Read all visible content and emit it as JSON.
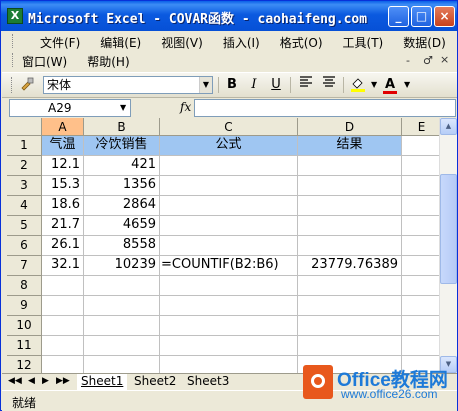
{
  "window": {
    "title": "Microsoft Excel - COVAR函数 - caohaifeng.com",
    "app_icon_glyph": "X"
  },
  "title_buttons": {
    "minimize": "_",
    "maximize": "□",
    "close": "×"
  },
  "menu": {
    "items": [
      "文件(F)",
      "编辑(E)",
      "视图(V)",
      "插入(I)",
      "格式(O)",
      "工具(T)",
      "数据(D)",
      "窗口(W)",
      "帮助(H)"
    ],
    "doc_controls": {
      "minimize": "-",
      "restore": "♂",
      "close": "×"
    }
  },
  "toolbar": {
    "font_name": "宋体",
    "bold": "B",
    "italic": "I",
    "underline": "U",
    "font_color_letter": "A"
  },
  "formula_bar": {
    "name_box": "A29",
    "fx": "fx",
    "content": ""
  },
  "sheet": {
    "columns": [
      "A",
      "B",
      "C",
      "D",
      "E"
    ],
    "rows": [
      "1",
      "2",
      "3",
      "4",
      "5",
      "6",
      "7",
      "8",
      "9",
      "10",
      "11",
      "12"
    ],
    "cells": {
      "A1": "气温",
      "B1": "冷饮销售",
      "C1": "公式",
      "D1": "结果",
      "A2": "12.1",
      "B2": "421",
      "A3": "15.3",
      "B3": "1356",
      "A4": "18.6",
      "B4": "2864",
      "A5": "21.7",
      "B5": "4659",
      "A6": "26.1",
      "B6": "8558",
      "A7": "32.1",
      "B7": "10239",
      "C7": "=COUNTIF(B2:B6)",
      "D7": "23779.76389"
    }
  },
  "tabs": {
    "sheets": [
      "Sheet1",
      "Sheet2",
      "Sheet3"
    ],
    "active": "Sheet1",
    "nav": [
      "◀◀",
      "◀",
      "▶",
      "▶▶"
    ]
  },
  "status": {
    "text": "就绪"
  },
  "watermark": {
    "line1": "Office教程网",
    "line2": "www.office26.com"
  },
  "colors": {
    "header_fill": "#9fc6f2",
    "selected_header": "#ffc08a",
    "title_blue": "#0b5ae0"
  }
}
